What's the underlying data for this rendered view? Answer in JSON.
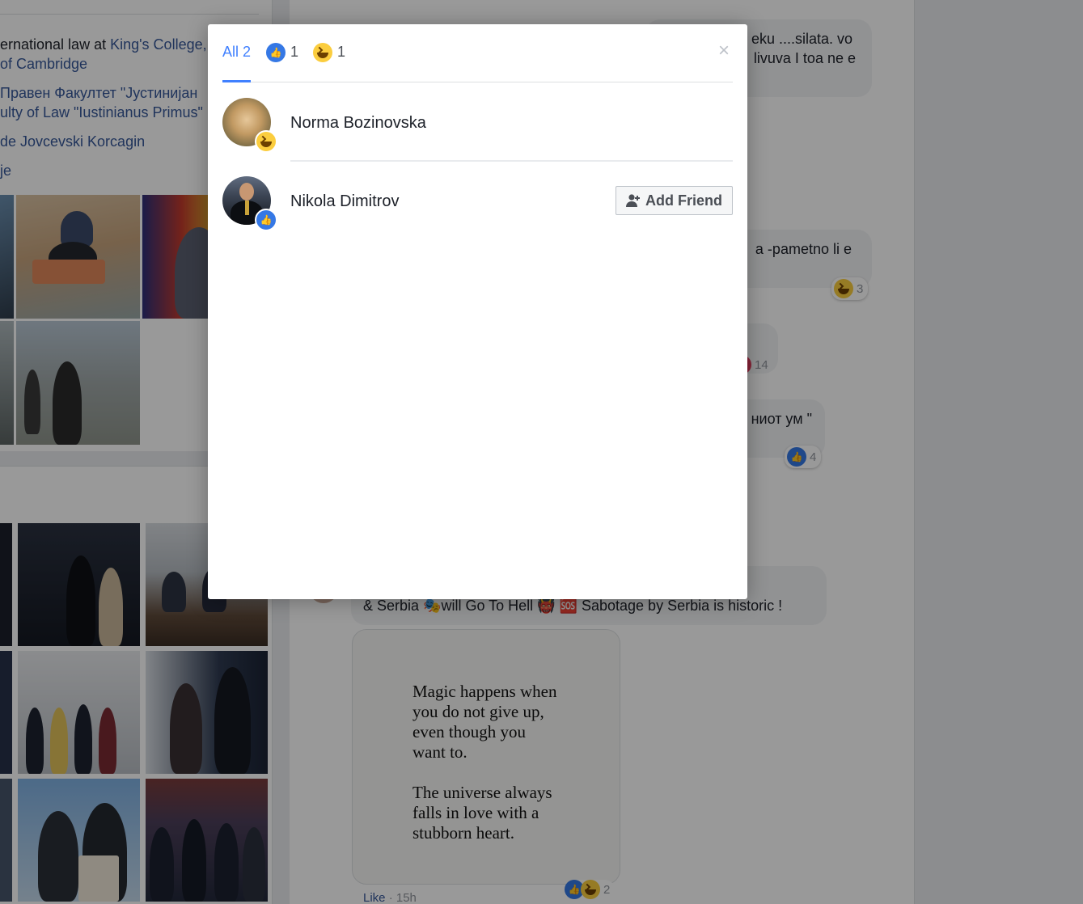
{
  "dialog": {
    "tabs": [
      {
        "label": "All 2"
      },
      {
        "icon": "like-reaction-icon",
        "count": "1"
      },
      {
        "icon": "haha-reaction-icon",
        "count": "1"
      }
    ],
    "close_label": "×",
    "people": [
      {
        "name": "Norma Bozinovska",
        "reaction": "haha"
      },
      {
        "name": "Nikola Dimitrov",
        "reaction": "like",
        "action_label": "Add Friend"
      }
    ]
  },
  "background": {
    "intro": {
      "line1_plain": "ernational law at ",
      "line1_link": "King's College,",
      "line2": "of Cambridge",
      "line3": "Правен Факултет \"Јустинијан",
      "line4": "ulty of Law \"Iustinianus Primus\"",
      "line5": "de Jovcevski Korcagin",
      "line6": "je"
    },
    "comments": [
      {
        "text_line1": "eku ....silata. vo",
        "text_line2": "livuva I toa ne e"
      },
      {
        "text": "a -pametno li e",
        "reaction_count": "3"
      },
      {
        "reaction_count": "14"
      },
      {
        "text": "ниот ум \"",
        "reaction_count": "4"
      },
      {
        "text": "& Serbia 🎭will Go To Hell 👹 🆘 Sabotage by Serbia is historic !"
      }
    ],
    "quote": "Magic happens when\nyou do not give up,\neven though you\nwant to.\n\nThe universe always\nfalls in love with a\nstubborn heart.",
    "quote_reaction_count": "2",
    "meta_like": "Like",
    "meta_time": " · 15h"
  },
  "colors": {
    "accent": "#4080ff",
    "like": "#3578e5",
    "haha": "#fbcd3e",
    "link": "#365899"
  }
}
